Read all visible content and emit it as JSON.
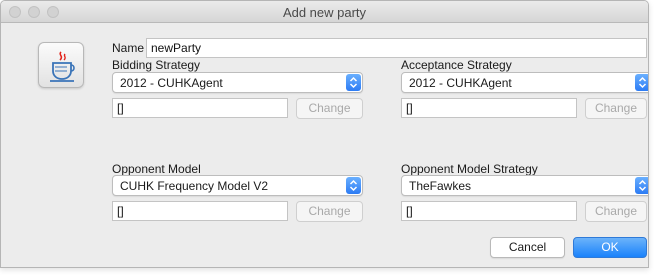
{
  "window": {
    "title": "Add new party"
  },
  "name": {
    "label": "Name",
    "value": "newParty"
  },
  "bidding_strategy": {
    "label": "Bidding Strategy",
    "selected": "2012 - CUHKAgent",
    "param_value": "[]",
    "change_label": "Change"
  },
  "acceptance_strategy": {
    "label": "Acceptance Strategy",
    "selected": "2012 - CUHKAgent",
    "param_value": "[]",
    "change_label": "Change"
  },
  "opponent_model": {
    "label": "Opponent Model",
    "selected": "CUHK Frequency Model V2",
    "param_value": "[]",
    "change_label": "Change"
  },
  "opponent_model_strategy": {
    "label": "Opponent Model Strategy",
    "selected": "TheFawkes",
    "param_value": "[]",
    "change_label": "Change"
  },
  "buttons": {
    "cancel": "Cancel",
    "ok": "OK"
  },
  "colors": {
    "accent": "#1a82fb",
    "window_bg": "#ececec"
  },
  "icons": {
    "app_icon": "java-coffee-cup-icon",
    "combo_arrow": "up-down-chevron-icon"
  }
}
